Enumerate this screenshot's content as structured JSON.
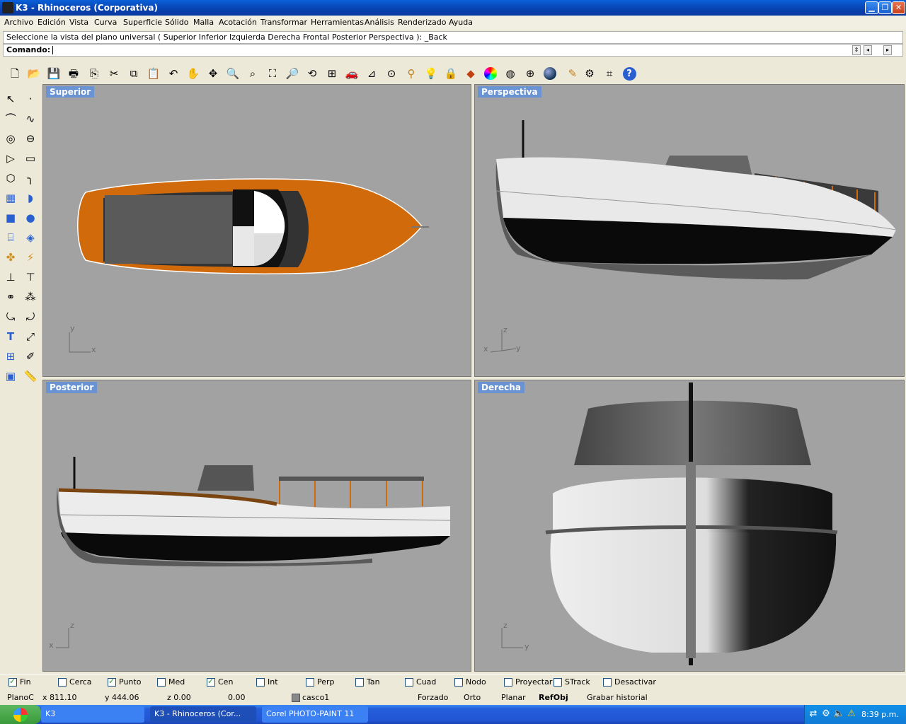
{
  "window": {
    "title": "K3 - Rhinoceros (Corporativa)"
  },
  "menu": [
    "Archivo",
    "Edición",
    "Vista",
    "Curva",
    "Superficie",
    "Sólido",
    "Malla",
    "Acotación",
    "Transformar",
    "Herramientas",
    "Análisis",
    "Renderizado",
    "Ayuda"
  ],
  "command": {
    "history": "Seleccione la vista del plano universal ( Superior  Inferior  Izquierda  Derecha  Frontal  Posterior  Perspectiva ): _Back",
    "prompt": "Comando:"
  },
  "toolbar_icons": [
    "new-file-icon",
    "open-folder-icon",
    "save-icon",
    "print-icon",
    "import-icon",
    "cut-icon",
    "copy-icon",
    "paste-icon",
    "undo-icon",
    "pan-hand-icon",
    "rotate-view-icon",
    "zoom-icon",
    "zoom-window-icon",
    "zoom-extents-icon",
    "zoom-selected-icon",
    "zoom-dynamic-icon",
    "four-viewports-icon",
    "car-render-icon",
    "cplane-icon",
    "osnap-icon",
    "gumball-icon",
    "light-icon",
    "lock-icon",
    "layer-icon",
    "color-wheel-icon",
    "sphere-icon",
    "shaded-icon",
    "rendered-sphere-icon",
    "pencil-icon",
    "settings-gear-icon",
    "grid-icon",
    "help-icon"
  ],
  "viewports": {
    "top_left": {
      "label": "Superior",
      "axis_h": "x",
      "axis_v": "y"
    },
    "top_right": {
      "label": "Perspectiva",
      "axis_h": "y",
      "axis_v": "z",
      "axis_neg": "x"
    },
    "bottom_left": {
      "label": "Posterior",
      "axis_h": "x",
      "axis_v": "z"
    },
    "bottom_right": {
      "label": "Derecha",
      "axis_h": "y",
      "axis_v": "z"
    }
  },
  "osnaps": [
    {
      "label": "Fin",
      "checked": true
    },
    {
      "label": "Cerca",
      "checked": false
    },
    {
      "label": "Punto",
      "checked": true
    },
    {
      "label": "Med",
      "checked": false
    },
    {
      "label": "Cen",
      "checked": true
    },
    {
      "label": "Int",
      "checked": false
    },
    {
      "label": "Perp",
      "checked": false
    },
    {
      "label": "Tan",
      "checked": false
    },
    {
      "label": "Cuad",
      "checked": false
    },
    {
      "label": "Nodo",
      "checked": false
    },
    {
      "label": "Proyectar",
      "checked": false
    },
    {
      "label": "STrack",
      "checked": false
    },
    {
      "label": "Desactivar",
      "checked": false
    }
  ],
  "status": {
    "cplane": "PlanoC",
    "x": "x 811.10",
    "y": "y 444.06",
    "z": "z 0.00",
    "dist": "0.00",
    "layer": "casco1",
    "forzado": "Forzado",
    "orto": "Orto",
    "planar": "Planar",
    "refobj": "RefObj",
    "historial": "Grabar historial"
  },
  "taskbar": {
    "items": [
      "K3",
      "K3 - Rhinoceros (Cor...",
      "Corel PHOTO-PAINT 11"
    ],
    "clock": "8:39 p.m."
  }
}
